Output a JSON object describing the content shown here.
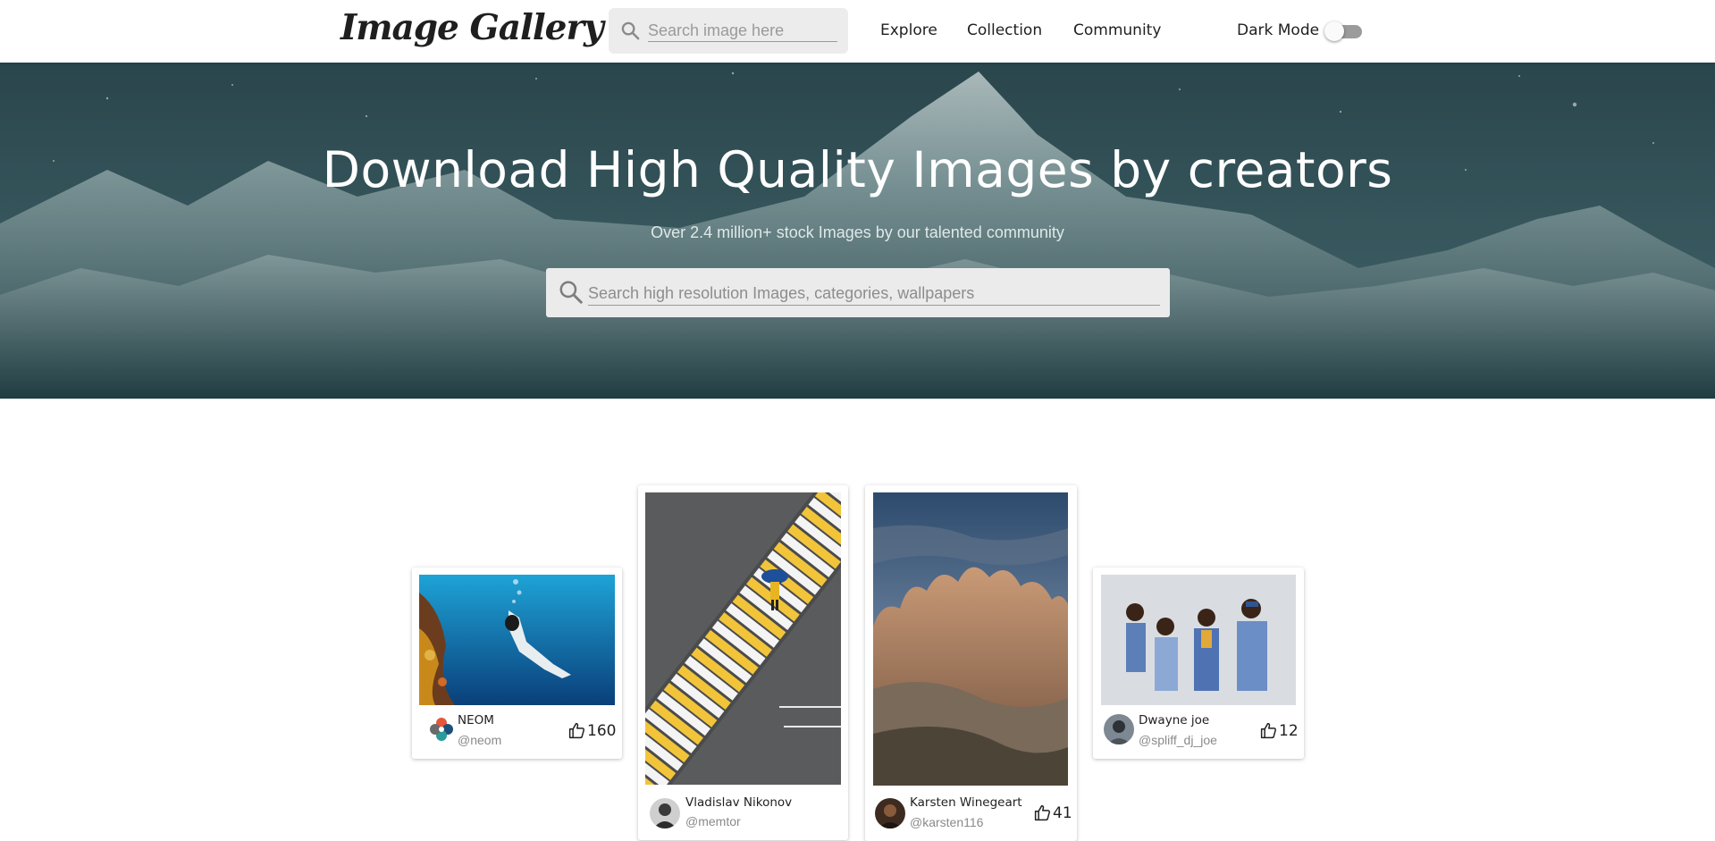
{
  "navbar": {
    "logo": "Image Gallery",
    "search_placeholder": "Search image here",
    "links": [
      "Explore",
      "Collection",
      "Community"
    ],
    "dark_mode_label": "Dark Mode",
    "dark_mode_on": false
  },
  "hero": {
    "title": "Download High Quality Images by creators",
    "subtitle": "Over 2.4 million+ stock Images by our talented community",
    "search_placeholder": "Search high resolution Images, categories, wallpapers"
  },
  "cards": [
    {
      "name": "NEOM",
      "handle": "@neom",
      "likes": "160",
      "icon": "thumbs-up-icon"
    },
    {
      "name": "Vladislav Nikonov",
      "handle": "@memtor",
      "likes": "",
      "icon": "thumbs-up-icon"
    },
    {
      "name": "Karsten Winegeart",
      "handle": "@karsten116",
      "likes": "41",
      "icon": "thumbs-up-icon"
    },
    {
      "name": "Dwayne joe",
      "handle": "@spliff_dj_joe",
      "likes": "12",
      "icon": "thumbs-up-icon"
    }
  ],
  "colors": {
    "navbar_bg": "#ffffff",
    "hero_overlay": "#2f4c53",
    "toggle_off": "#9b9b9b"
  }
}
